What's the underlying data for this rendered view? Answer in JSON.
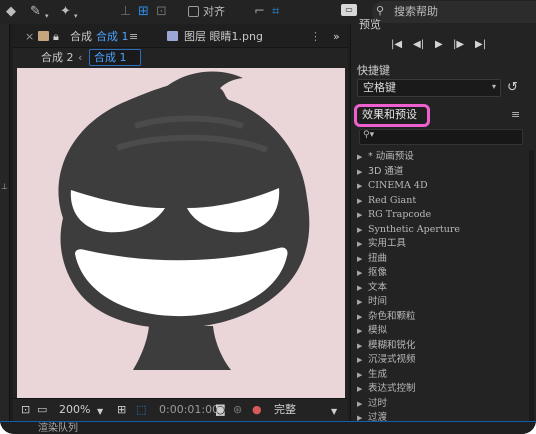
{
  "toolbar": {
    "snap_label": "对齐",
    "search_placeholder": "搜索帮助"
  },
  "composition": {
    "tab_title": "合成",
    "tab_active": "合成 1",
    "layer_tab": "图层 眼睛1.png",
    "breadcrumb_parent": "合成 2",
    "breadcrumb_current": "合成 1",
    "zoom": "200%",
    "timecode": "0:00:01:00",
    "quality": "完整"
  },
  "right_panel": {
    "preview_title": "预览",
    "shortcut_label": "快捷键",
    "shortcut_value": "空格键",
    "effects_title": "效果和预设",
    "effects": [
      "* 动画预设",
      "3D 通道",
      "CINEMA 4D",
      "Red Giant",
      "RG Trapcode",
      "Synthetic Aperture",
      "实用工具",
      "扭曲",
      "抠像",
      "文本",
      "时间",
      "杂色和颗粒",
      "模拟",
      "模糊和锐化",
      "沉浸式视频",
      "生成",
      "表达式控制",
      "过时",
      "过渡"
    ]
  },
  "bottom": {
    "render_queue": "渲染队列"
  },
  "colors": {
    "viewer_bg": "#ead6d8",
    "character": "#3d3d3d",
    "highlight": "#ee5fd0",
    "accent_blue": "#2d8ceb"
  }
}
